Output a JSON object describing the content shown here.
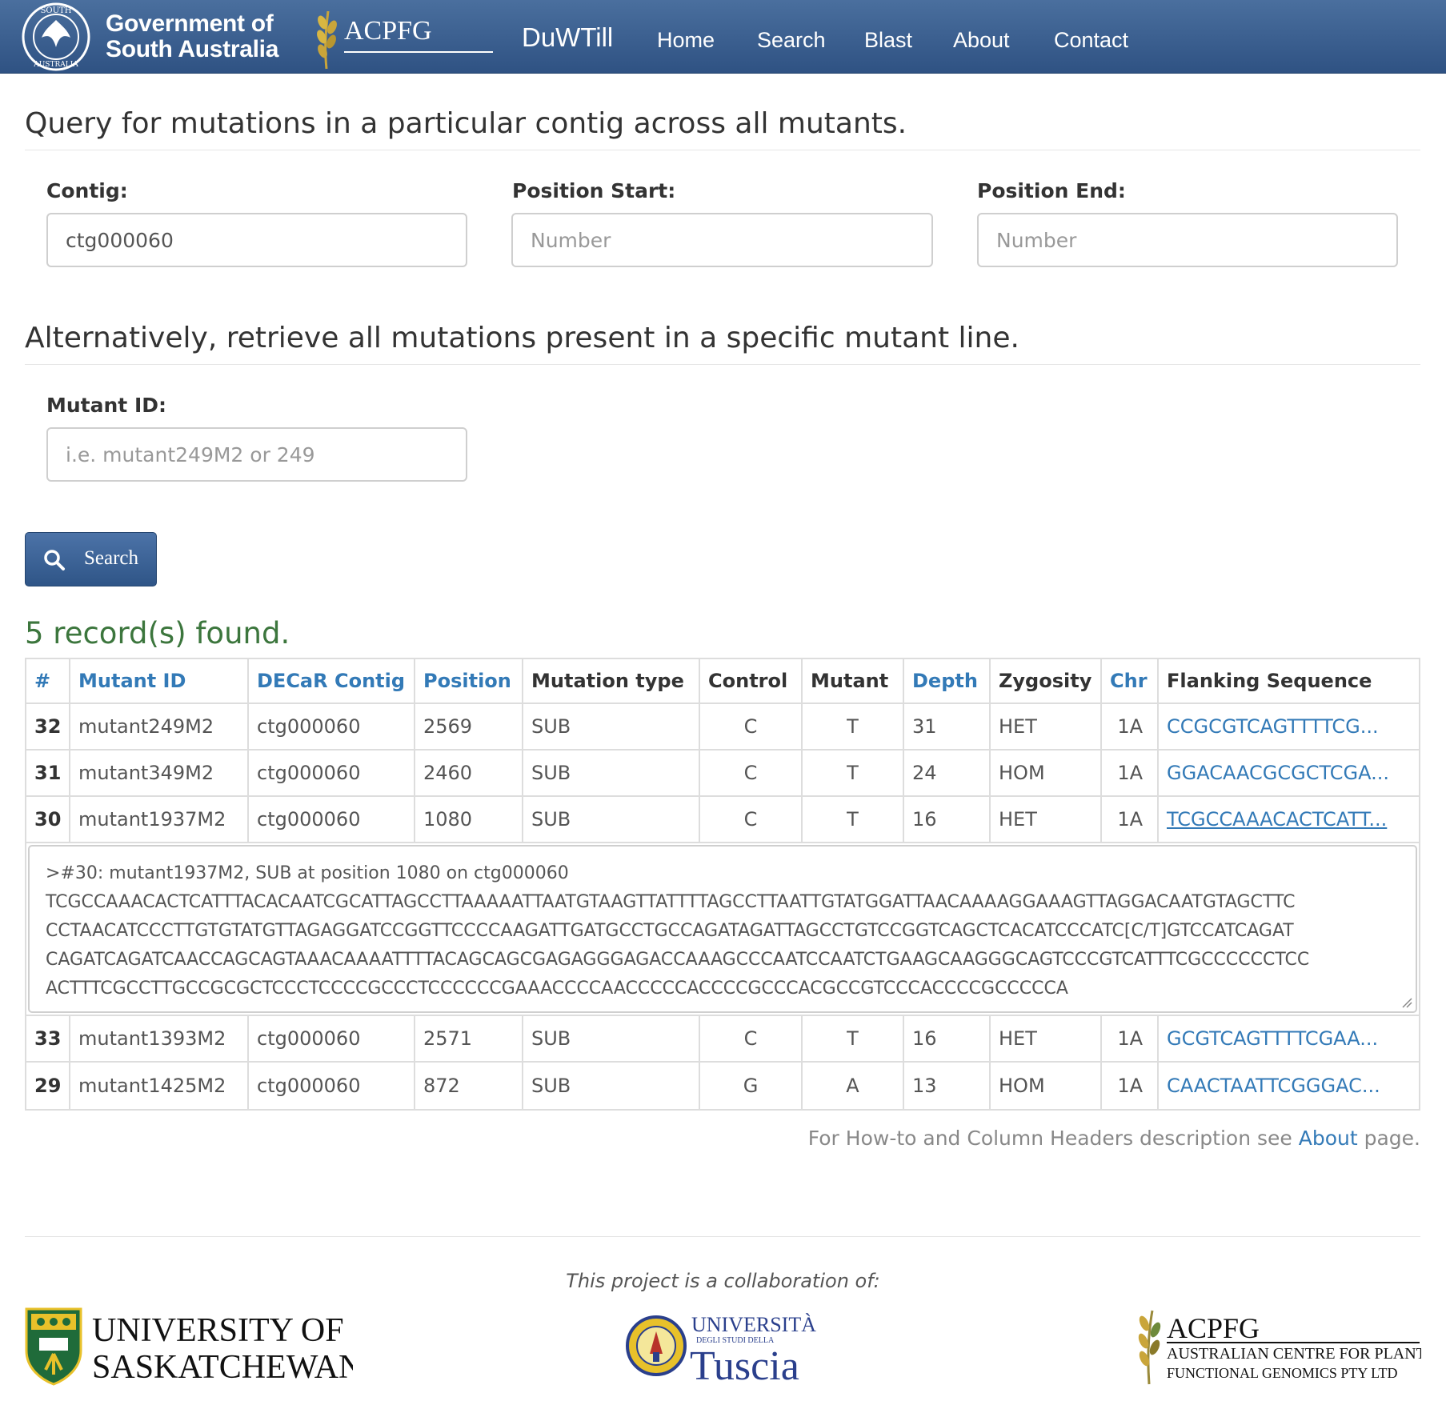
{
  "navbar": {
    "gov_line1": "Government of",
    "gov_line2": "South Australia",
    "seal_text_top": "SOUTH",
    "seal_text_bottom": "AUSTRALIA",
    "brand": "ACPFG",
    "app_name": "DuWTill",
    "links": [
      "Home",
      "Search",
      "Blast",
      "About",
      "Contact"
    ]
  },
  "query": {
    "heading": "Query for mutations in a particular contig across all mutants.",
    "contig_label": "Contig:",
    "contig_value": "ctg000060",
    "start_label": "Position Start:",
    "start_placeholder": "Number",
    "end_label": "Position End:",
    "end_placeholder": "Number"
  },
  "mutant_query": {
    "heading": "Alternatively, retrieve all mutations present in a specific mutant line.",
    "label": "Mutant ID:",
    "placeholder": "i.e. mutant249M2 or 249"
  },
  "search_button": "Search",
  "results": {
    "summary": "5 record(s) found.",
    "columns": [
      "#",
      "Mutant ID",
      "DECaR Contig",
      "Position",
      "Mutation type",
      "Control",
      "Mutant",
      "Depth",
      "Zygosity",
      "Chr",
      "Flanking Sequence"
    ],
    "rows": [
      [
        "32",
        "mutant249M2",
        "ctg000060",
        "2569",
        "SUB",
        "C",
        "T",
        "31",
        "HET",
        "1A",
        "CCGCGTCAGTTTTCG..."
      ],
      [
        "31",
        "mutant349M2",
        "ctg000060",
        "2460",
        "SUB",
        "C",
        "T",
        "24",
        "HOM",
        "1A",
        "GGACAACGCGCTCGA..."
      ],
      [
        "30",
        "mutant1937M2",
        "ctg000060",
        "1080",
        "SUB",
        "C",
        "T",
        "16",
        "HET",
        "1A",
        "TCGCCAAACACTCATT..."
      ],
      [
        "33",
        "mutant1393M2",
        "ctg000060",
        "2571",
        "SUB",
        "C",
        "T",
        "16",
        "HET",
        "1A",
        "GCGTCAGTTTTCGAA..."
      ],
      [
        "29",
        "mutant1425M2",
        "ctg000060",
        "872",
        "SUB",
        "G",
        "A",
        "13",
        "HOM",
        "1A",
        "CAACTAATTCGGGAC..."
      ]
    ],
    "expanded_sequence": {
      "header": ">#30: mutant1937M2, SUB at position 1080 on ctg000060",
      "lines": [
        "TCGCCAAACACTCATTTACACAATCGCATTAGCCTTAAAAATTAATGTAAGTTATTTTAGCCTTAATTGTATGGATTAACAAAAGGAAAGTTAGGACAATGTAGCTTC",
        "CCTAACATCCCTTGTGTATGTTAGAGGATCCGGTTCCCCAAGATTGATGCCTGCCAGATAGATTAGCCTGTCCGGTCAGCTCACATCCCATC[C/T]GTCCATCAGAT",
        "CAGATCAGATCAACCAGCAGTAAACAAAATTTTACAGCAGCGAGAGGGAGACCAAAGCCCAATCCAATCTGAAGCAAGGGCAGTCCCGTCATTTCGCCCCCCTCC",
        "ACTTTCGCCTTGCCGCGCTCCCTCCCCGCCCTCCCCCCGAAACCCCAACCCCCACCCCGCCCACGCCGTCCCACCCCGCCCCCA"
      ]
    }
  },
  "about_note": {
    "prefix": "For How-to and Column Headers description see ",
    "link": "About",
    "suffix": " page."
  },
  "footer": {
    "collab": "This project is a collaboration of:",
    "usask_line1": "UNIVERSITY OF",
    "usask_line2": "SASKATCHEWAN",
    "tuscia_line1": "UNIVERSITÀ",
    "tuscia_line2": "DEGLI STUDI DELLA",
    "tuscia_line3": "Tuscia",
    "acpfg_title": "ACPFG",
    "acpfg_line1": "AUSTRALIAN CENTRE FOR PLANT",
    "acpfg_line2": "FUNCTIONAL GENOMICS PTY LTD"
  },
  "colors": {
    "navbar": "#2f5283",
    "link": "#337ab7",
    "success_text": "#3c763d",
    "usask_green": "#1f6b3a",
    "usask_gold": "#e8c12a"
  },
  "icons": [
    "search-icon",
    "government-seal-icon",
    "wheat-icon",
    "resize-handle-icon"
  ]
}
